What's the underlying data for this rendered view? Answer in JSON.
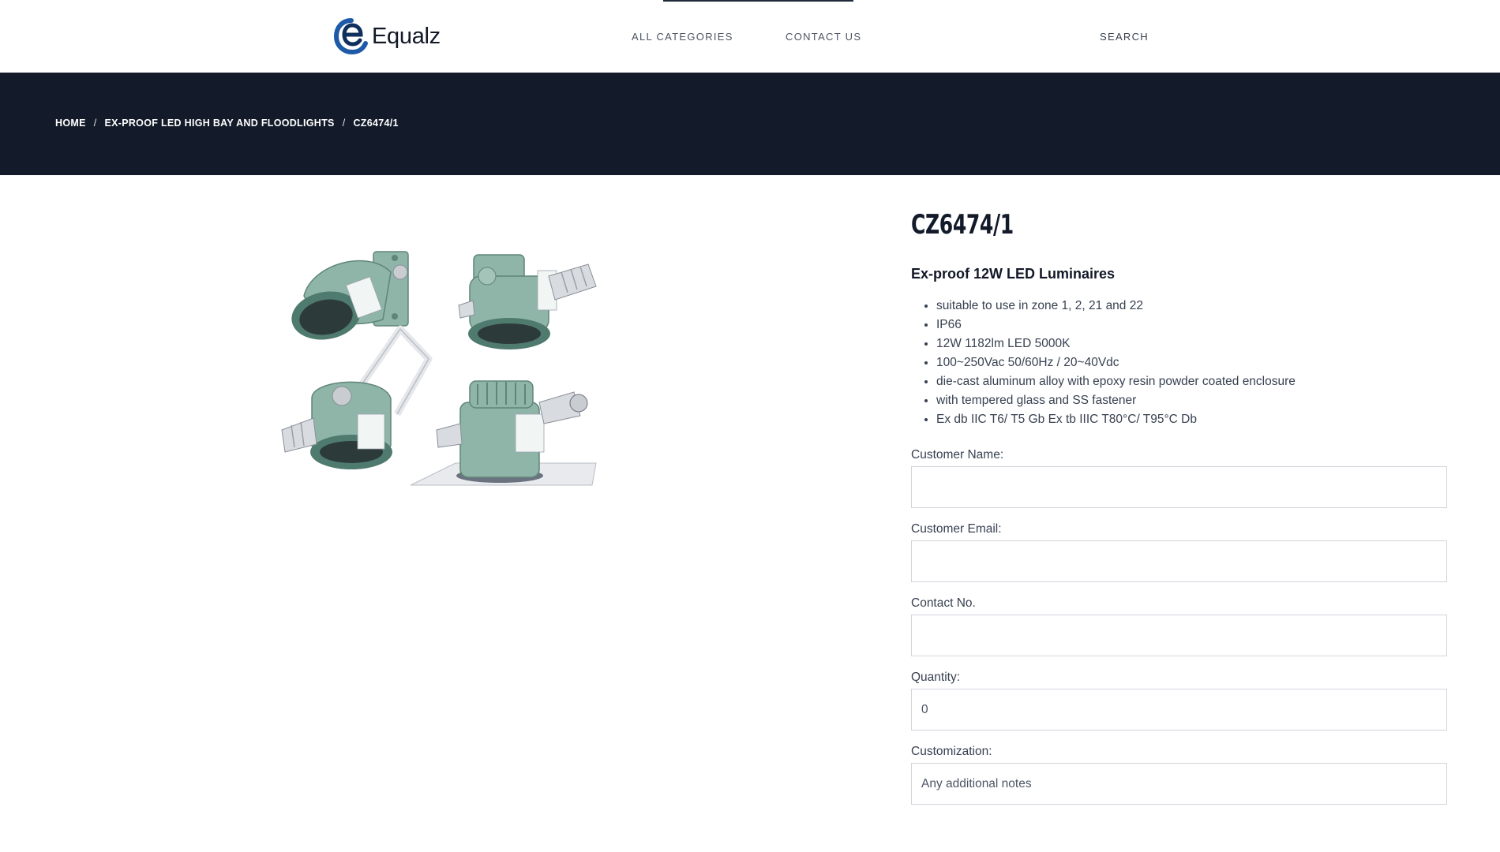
{
  "header": {
    "logo_text": "Equalz",
    "nav": {
      "all_categories": "ALL CATEGORIES",
      "contact_us": "CONTACT US",
      "search": "SEARCH"
    },
    "brand_color": "#1e5aa8"
  },
  "breadcrumb": {
    "home": "HOME",
    "category": "EX-PROOF LED HIGH BAY AND FLOODLIGHTS",
    "current": "CZ6474/1",
    "separator": "/"
  },
  "product": {
    "title": "CZ6474/1",
    "subtitle": "Ex-proof 12W LED Luminaires",
    "features": [
      "suitable to use in zone 1, 2, 21 and 22",
      "IP66",
      "12W 1182lm LED 5000K",
      "100~250Vac 50/60Hz / 20~40Vdc",
      "die-cast aluminum alloy with epoxy resin powder coated enclosure",
      "with tempered glass and SS fastener",
      "Ex db IIC T6/ T5 Gb Ex tb IIIC T80°C/ T95°C Db"
    ]
  },
  "form": {
    "customer_name": {
      "label": "Customer Name:",
      "value": ""
    },
    "customer_email": {
      "label": "Customer Email:",
      "value": ""
    },
    "contact_no": {
      "label": "Contact No.",
      "value": ""
    },
    "quantity": {
      "label": "Quantity:",
      "value": "0"
    },
    "customization": {
      "label": "Customization:",
      "placeholder": "Any additional notes",
      "value": ""
    }
  },
  "colors": {
    "banner_bg": "#131a29",
    "luminaire_body": "#8fb5a8"
  }
}
